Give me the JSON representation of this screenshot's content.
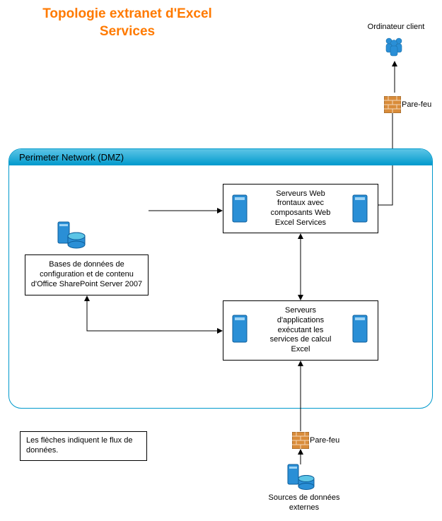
{
  "title_line1": "Topologie extranet d'Excel",
  "title_line2": "Services",
  "client_label": "Ordinateur client",
  "firewall_label": "Pare-feu",
  "dmz_header": "Perimeter Network (DMZ)",
  "db_box": "Bases de données de configuration et de contenu d'Office SharePoint Server 2007",
  "web_box": "Serveurs Web frontaux avec composants Web Excel Services",
  "app_box": "Serveurs d'applications exécutant les services de calcul Excel",
  "legend": "Les flèches indiquent le flux de données.",
  "ext_src": "Sources de données externes"
}
